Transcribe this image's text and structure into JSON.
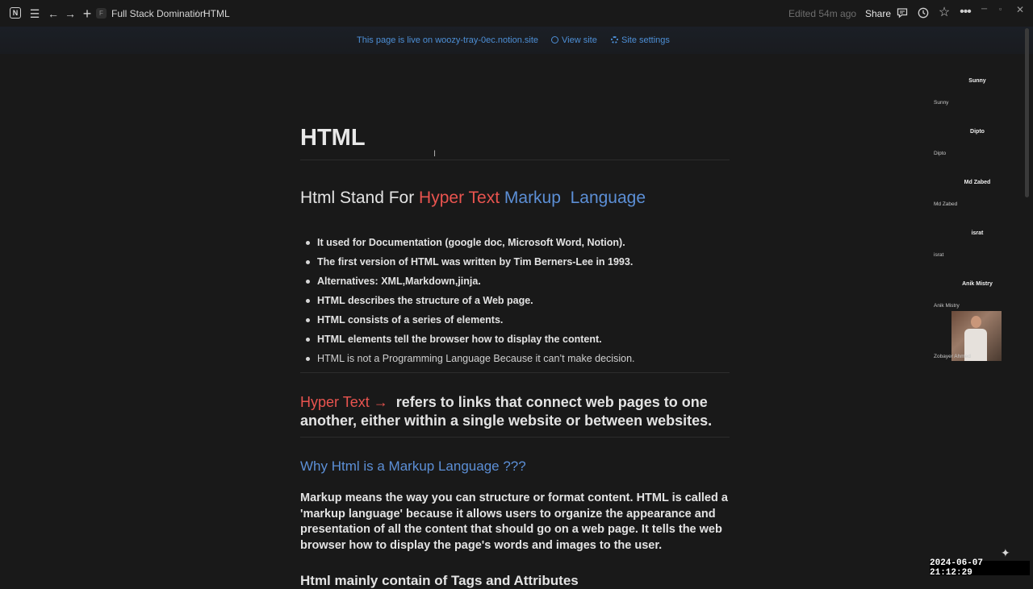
{
  "topbar": {
    "logo": "N",
    "page_emoji": "F",
    "breadcrumb_root": "Full Stack Domination",
    "breadcrumb_sep": "/",
    "breadcrumb_page": "HTML",
    "edited": "Edited 54m ago",
    "share": "Share",
    "icons": [
      "notion-logo",
      "menu-icon",
      "back-arrow-icon",
      "forward-arrow-icon",
      "plus-icon",
      "comment-icon",
      "clock-icon",
      "star-icon",
      "more-icon",
      "minimize-icon",
      "maximize-icon",
      "close-icon"
    ]
  },
  "banner": {
    "live_text": "This page is live on woozy-tray-0ec.notion.site",
    "view_site": "View site",
    "site_settings": "Site settings"
  },
  "page": {
    "title": "HTML",
    "stand_for": {
      "prefix": "Html Stand For ",
      "hyper_text": "Hyper Text",
      "markup": "Markup",
      "language": "Language"
    },
    "bullets": [
      "It used for Documentation (google doc, Microsoft Word, Notion).",
      "The first version of HTML was written by Tim Berners-Lee in 1993.",
      "Alternatives: XML,Markdown,jinja.",
      " HTML describes the structure of a Web page.",
      "HTML consists of a series of elements.",
      "HTML elements tell the browser how to display the content.",
      "HTML is not a Programming Language Because it can’t make decision."
    ],
    "hyper_text_def": {
      "term": "Hyper Text →",
      "text": "refers to links that connect web pages to one another, either within a single website or between websites."
    },
    "why_heading": "Why Html is a Markup Language ???",
    "markup_paragraph": "Markup means the way you can structure or format content. HTML is called a 'markup language' because it allows users to organize the appearance and presentation of all the content that should go on a web page. It tells the web browser how to display the page's words and images to the user.",
    "cutoff_heading": "Html mainly contain of Tags and Attributes"
  },
  "participants": [
    {
      "name": "Sunny",
      "label": "Sunny"
    },
    {
      "name": "Dipto",
      "label": "Dipto"
    },
    {
      "name": "Md Zabed",
      "label": "Md Zabed"
    },
    {
      "name": "israt",
      "label": "israt"
    },
    {
      "name": "Anik Mistry",
      "label": "Anik Mistry"
    },
    {
      "name": "",
      "label": "Zobayer Ahmed"
    }
  ],
  "timestamp": "2024-06-07  21:12:29",
  "colors": {
    "background": "#191919",
    "red_accent": "#e9544f",
    "blue_accent": "#5c8fd6",
    "banner_link": "#4d8fd6"
  }
}
